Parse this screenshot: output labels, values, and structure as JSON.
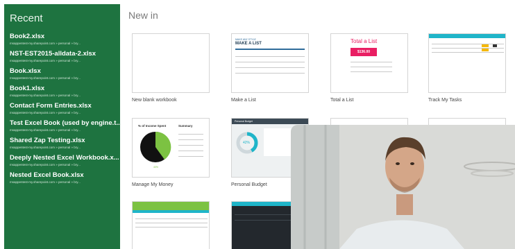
{
  "sidebar": {
    "title": "Recent",
    "items": [
      {
        "name": "Book2.xlsx",
        "path": "msappentest-my.sharepoint.com » personal » bry..."
      },
      {
        "name": "NST-EST2015-alldata-2.xlsx",
        "path": "msappentest-my.sharepoint.com » personal » bry..."
      },
      {
        "name": "Book.xlsx",
        "path": "msappentest-my.sharepoint.com » personal » bry..."
      },
      {
        "name": "Book1.xlsx",
        "path": "msappentest-my.sharepoint.com » personal » bry..."
      },
      {
        "name": "Contact Form Entries.xlsx",
        "path": "msappentest-my.sharepoint.com » personal » bry..."
      },
      {
        "name": "Test Excel Book (used by engine.t...",
        "path": "msappentest-my.sharepoint.com » personal » bry..."
      },
      {
        "name": "Shared Zap Testing.xlsx",
        "path": "msappentest-my.sharepoint.com » personal » bry..."
      },
      {
        "name": "Deeply Nested Excel Workbook.x...",
        "path": "msappentest-my.sharepoint.com » personal » bry..."
      },
      {
        "name": "Nested Excel Book.xlsx",
        "path": "msappentest-my.sharepoint.com » personal » bry..."
      }
    ]
  },
  "main": {
    "title": "New in",
    "templates": [
      {
        "label": "New blank workbook"
      },
      {
        "label": "Make a List",
        "heading": "MAKE A LIST",
        "kicker": "MAKE ANY STYLE"
      },
      {
        "label": "Total a List",
        "heading": "Total a List",
        "amount": "$136.00"
      },
      {
        "label": "Track My Tasks"
      },
      {
        "label": "Manage My Money",
        "chart_title": "% of Income Spent",
        "summary_title": "Summary",
        "pct": "40%"
      },
      {
        "label": "Personal Budget",
        "header": "Personal Budget",
        "pct": "42%"
      },
      {
        "label": ""
      },
      {
        "label": ""
      }
    ]
  },
  "colors": {
    "sidebar_bg": "#1e7340",
    "accent_pink": "#e91e63",
    "accent_green": "#7cc242",
    "teal": "#1fb5c9"
  }
}
